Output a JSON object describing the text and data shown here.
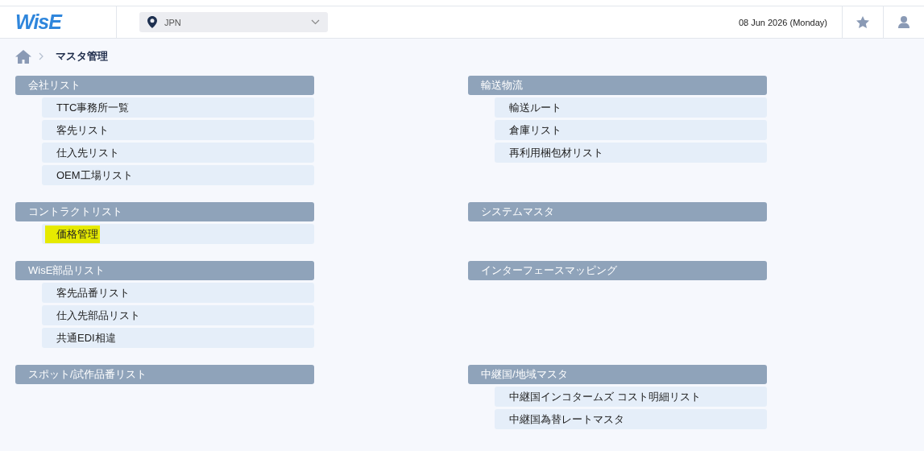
{
  "header": {
    "logo": "WisE",
    "country": "JPN",
    "date": "08 Jun 2026 (Monday)"
  },
  "breadcrumb": {
    "title": "マスタ管理"
  },
  "sections": [
    {
      "title": "会社リスト",
      "items": [
        {
          "label": "TTC事務所一覧",
          "highlighted": false
        },
        {
          "label": "客先リスト",
          "highlighted": false
        },
        {
          "label": "仕入先リスト",
          "highlighted": false
        },
        {
          "label": "OEM工場リスト",
          "highlighted": false
        }
      ]
    },
    {
      "title": "輸送物流",
      "items": [
        {
          "label": "輸送ルート",
          "highlighted": false
        },
        {
          "label": "倉庫リスト",
          "highlighted": false
        },
        {
          "label": "再利用梱包材リスト",
          "highlighted": false
        }
      ]
    },
    {
      "title": "コントラクトリスト",
      "items": [
        {
          "label": "価格管理",
          "highlighted": true
        }
      ]
    },
    {
      "title": "システムマスタ"
    },
    {
      "title": "WisE部品リスト",
      "items": [
        {
          "label": "客先品番リスト",
          "highlighted": false
        },
        {
          "label": "仕入先部品リスト",
          "highlighted": false
        },
        {
          "label": "共通EDI相違",
          "highlighted": false
        }
      ]
    },
    {
      "title": "インターフェースマッピング"
    },
    {
      "title": "スポット/試作品番リスト"
    },
    {
      "title": "中継国/地域マスタ",
      "items": [
        {
          "label": "中継国インコタームズ コスト明細リスト",
          "highlighted": false
        },
        {
          "label": "中継国為替レートマスタ",
          "highlighted": false
        }
      ]
    }
  ]
}
